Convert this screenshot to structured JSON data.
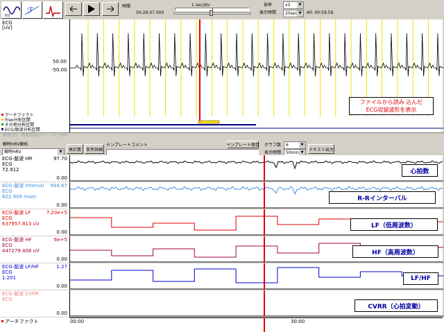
{
  "toolbar": {
    "time_label": "時間",
    "time_scale": "1 sec/div",
    "current_time": "00:26:07.000",
    "magnify_label": "倍率",
    "magnify_value": "x3",
    "display_time_label": "表示時間",
    "display_time_value": "20sec",
    "all_label": "All: 00:59:59"
  },
  "ecg": {
    "channel": "ECG",
    "unit": "[uV]",
    "tick_pos": "50.00",
    "tick_neg": "-50.00",
    "annotation_line1": "ファイルから読み 込んだ",
    "annotation_line2": "ECG収録波形を表示"
  },
  "legend": [
    "アーチファクト",
    "Free分析区間",
    "その他分析区間",
    "ECG/脈波分析区間"
  ],
  "divider_label": "解析(S)　時系列(R)ウィンドウ(W)",
  "controls": {
    "mode_label": "瞬時HRV解析",
    "mode_select": "瞬時HRV",
    "recalc": "再計算",
    "conditions": "条件詳細",
    "template_comment": "テンプレートコメント",
    "template_save": "テンプレート保存",
    "graph_count_label": "グラフ数",
    "graph_count_value": "6",
    "display_time_label": "表示時間",
    "display_time_value": "50min.",
    "text_output": "テキスト出力"
  },
  "charts": [
    {
      "title": "ECG-脈波 HR",
      "source": "ECG",
      "value": "72.912",
      "ymax": "97.70",
      "ymin": "0.00",
      "annotation": "心拍数",
      "color": "#000000"
    },
    {
      "title": "ECG-脈波 Interval",
      "source": "ECG",
      "value": "822.909 msec",
      "ymax": "994.67",
      "ymin": "0.00",
      "annotation": "R-Rインターバル",
      "color": "#3c8cdc"
    },
    {
      "title": "ECG-脈波 LF",
      "source": "ECG",
      "value": "637957.813 uV",
      "ymax": "7.23e+5",
      "ymin": "0.00",
      "annotation": "LF（低周波数）",
      "color": "#e00000"
    },
    {
      "title": "ECG-脈波 HF",
      "source": "ECG",
      "value": "447279.406 uV",
      "ymax": "6e+5",
      "ymin": "0.00",
      "annotation": "HF（高周波数）",
      "color": "#a00040"
    },
    {
      "title": "ECG-脈波 LF/HF",
      "source": "ECG",
      "value": "1.201",
      "ymax": "1.27",
      "ymin": "0.00",
      "annotation": "LF/HF",
      "color": "#0000d0"
    },
    {
      "title": "ECG-脈波 CVRR",
      "source": "ECG",
      "value": "",
      "ymax": "",
      "ymin": "0.00",
      "annotation": "CVRR（心拍変動）",
      "color": "#f08080"
    }
  ],
  "bottom": {
    "artifact": "アーチファクト",
    "t0": "00:00",
    "t1": "30:00"
  }
}
